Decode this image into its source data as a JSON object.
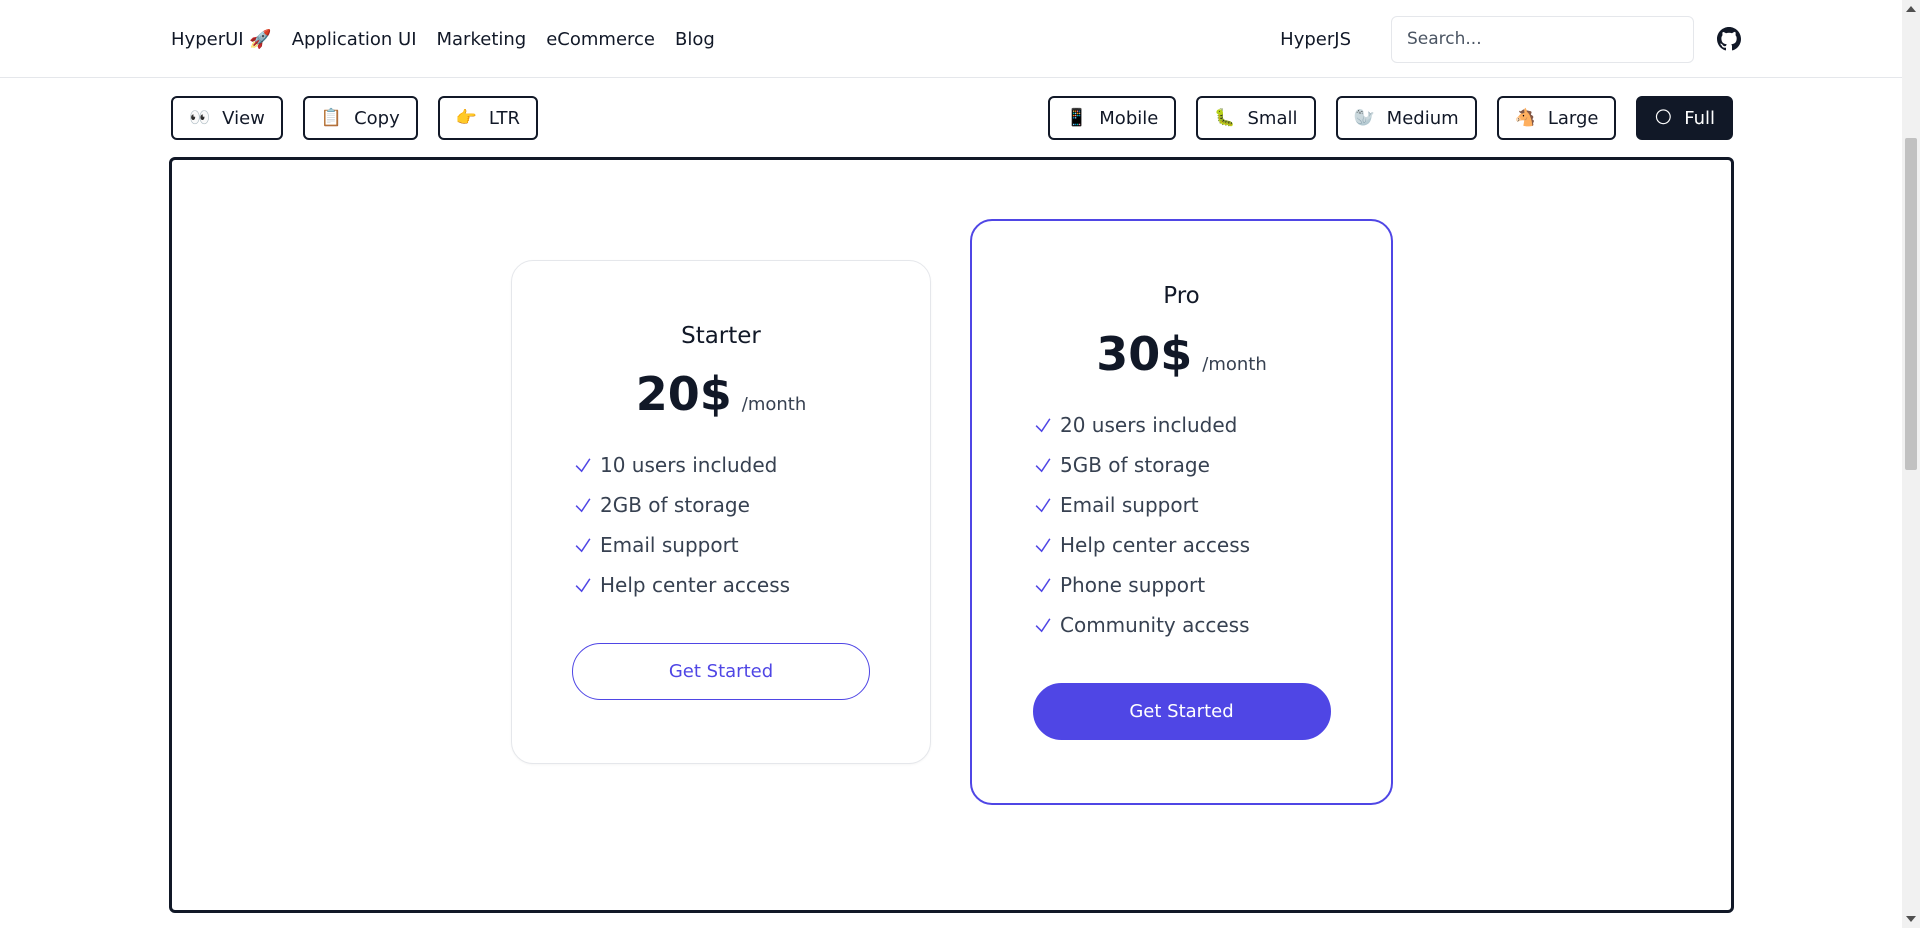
{
  "nav": {
    "brand": "HyperUI 🚀",
    "links": [
      "Application UI",
      "Marketing",
      "eCommerce",
      "Blog"
    ],
    "hyperjs": "HyperJS",
    "search_placeholder": "Search...",
    "github_icon": "github-icon"
  },
  "toolbar": {
    "left": [
      {
        "emoji": "👀",
        "label": "View"
      },
      {
        "emoji": "📋",
        "label": "Copy"
      },
      {
        "emoji": "👉",
        "label": "LTR"
      }
    ],
    "right": [
      {
        "emoji": "📱",
        "label": "Mobile"
      },
      {
        "emoji": "🐛",
        "label": "Small"
      },
      {
        "emoji": "🦭",
        "label": "Medium"
      },
      {
        "emoji": "🐴",
        "label": "Large"
      },
      {
        "emoji": "🌕",
        "label": "Full"
      }
    ],
    "active": "Full"
  },
  "plans": [
    {
      "name": "Starter",
      "price": "20$",
      "period": "/month",
      "features": [
        "10 users included",
        "2GB of storage",
        "Email support",
        "Help center access"
      ],
      "cta": "Get Started",
      "highlighted": false
    },
    {
      "name": "Pro",
      "price": "30$",
      "period": "/month",
      "features": [
        "20 users included",
        "5GB of storage",
        "Email support",
        "Help center access",
        "Phone support",
        "Community access"
      ],
      "cta": "Get Started",
      "highlighted": true
    }
  ],
  "colors": {
    "accent": "#4f46e5",
    "dark": "#111827",
    "border": "#e5e7eb"
  }
}
